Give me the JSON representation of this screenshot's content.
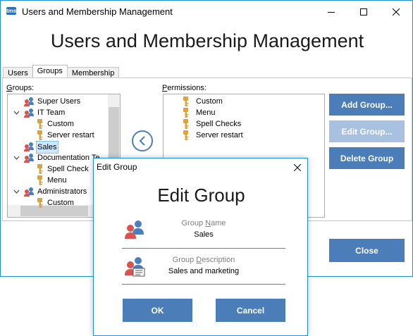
{
  "window": {
    "app_icon_text": "tms",
    "title": "Users and Membership Management"
  },
  "heading": "Users and Membership Management",
  "tabs": [
    {
      "label": "Users",
      "active": false
    },
    {
      "label": "Groups",
      "active": true
    },
    {
      "label": "Membership",
      "active": false
    }
  ],
  "groups_panel": {
    "label_prefix": "G",
    "label_rest": "roups:",
    "items": [
      {
        "label": "Super Users",
        "level": 0,
        "type": "group",
        "expanded": null
      },
      {
        "label": "IT Team",
        "level": 0,
        "type": "group",
        "expanded": true
      },
      {
        "label": "Custom",
        "level": 1,
        "type": "permission"
      },
      {
        "label": "Server restart",
        "level": 1,
        "type": "permission"
      },
      {
        "label": "Sales",
        "level": 0,
        "type": "group",
        "selected": true
      },
      {
        "label": "Documentation Te",
        "level": 0,
        "type": "group",
        "expanded": true
      },
      {
        "label": "Spell Check",
        "level": 1,
        "type": "permission"
      },
      {
        "label": "Menu",
        "level": 1,
        "type": "permission"
      },
      {
        "label": "Administrators",
        "level": 0,
        "type": "group",
        "expanded": true
      },
      {
        "label": "Custom",
        "level": 1,
        "type": "permission"
      }
    ]
  },
  "permissions_panel": {
    "label_prefix": "P",
    "label_rest": "ermissions:",
    "items": [
      {
        "label": "Custom"
      },
      {
        "label": "Menu"
      },
      {
        "label": "Spell Checks"
      },
      {
        "label": "Server restart"
      }
    ]
  },
  "buttons": {
    "add_group": "Add Group...",
    "edit_group": "Edit Group...",
    "delete_group": "Delete Group",
    "close": "Close"
  },
  "dialog": {
    "title": "Edit Group",
    "heading": "Edit Group",
    "name_label_pre": "Group ",
    "name_label_u": "N",
    "name_label_post": "ame",
    "name_value": "Sales",
    "desc_label_pre": "Group ",
    "desc_label_u": "D",
    "desc_label_post": "escription",
    "desc_value": "Sales and marketing",
    "ok": "OK",
    "cancel": "Cancel"
  },
  "colors": {
    "accent": "#4b7db8",
    "accent_disabled": "#a9c1e0",
    "window_border": "#1e90d6",
    "selection": "#cce8ff",
    "key_icon": "#d9a441",
    "user_red": "#d9534f",
    "user_blue": "#4a7fbd"
  },
  "icons": {
    "group": "users-group-icon",
    "permission": "key-icon",
    "move_left": "chevron-left-circle-icon",
    "minimize": "minimize-icon",
    "maximize": "maximize-icon",
    "close": "close-icon"
  }
}
